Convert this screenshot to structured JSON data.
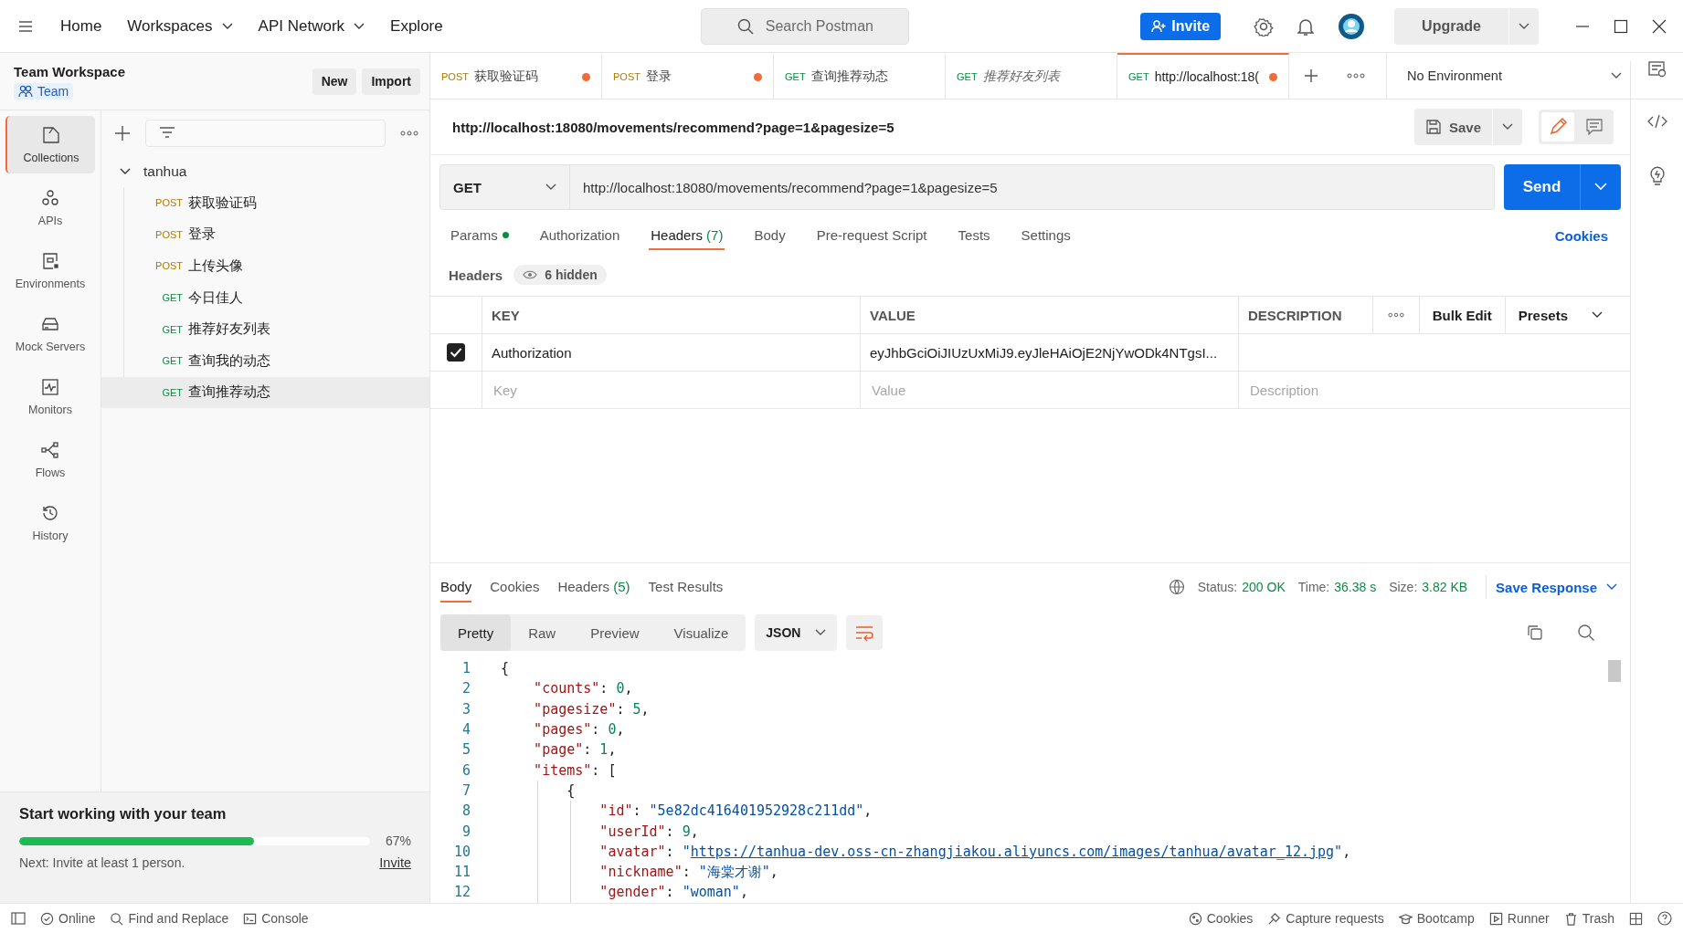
{
  "topbar": {
    "nav": [
      {
        "label": "Home",
        "dropdown": false
      },
      {
        "label": "Workspaces",
        "dropdown": true
      },
      {
        "label": "API Network",
        "dropdown": true
      },
      {
        "label": "Explore",
        "dropdown": false
      }
    ],
    "search_placeholder": "Search Postman",
    "invite": "Invite",
    "upgrade": "Upgrade"
  },
  "workspace": {
    "title": "Team Workspace",
    "badge": "Team",
    "buttons": [
      "New",
      "Import"
    ]
  },
  "rail": [
    {
      "kind": "collections",
      "label": "Collections",
      "selected": true
    },
    {
      "kind": "apis",
      "label": "APIs",
      "selected": false
    },
    {
      "kind": "environments",
      "label": "Environments",
      "selected": false
    },
    {
      "kind": "mock",
      "label": "Mock Servers",
      "selected": false
    },
    {
      "kind": "monitors",
      "label": "Monitors",
      "selected": false
    },
    {
      "kind": "flows",
      "label": "Flows",
      "selected": false
    },
    {
      "kind": "history",
      "label": "History",
      "selected": false
    }
  ],
  "collection": {
    "name": "tanhua",
    "expanded": true,
    "requests": [
      {
        "method": "POST",
        "name": "获取验证码",
        "selected": false
      },
      {
        "method": "POST",
        "name": "登录",
        "selected": false
      },
      {
        "method": "POST",
        "name": "上传头像",
        "selected": false
      },
      {
        "method": "GET",
        "name": "今日佳人",
        "selected": false
      },
      {
        "method": "GET",
        "name": "推荐好友列表",
        "selected": false
      },
      {
        "method": "GET",
        "name": "查询我的动态",
        "selected": false
      },
      {
        "method": "GET",
        "name": "查询推荐动态",
        "selected": true
      }
    ]
  },
  "onboarding": {
    "title": "Start working with your team",
    "level": 0.67,
    "percent": "67%",
    "next": "Next: Invite at least 1 person.",
    "link": "Invite"
  },
  "tabs": [
    {
      "method": "POST",
      "name": "获取验证码",
      "unsaved": true,
      "preview": false,
      "selected": false
    },
    {
      "method": "POST",
      "name": "登录",
      "unsaved": true,
      "preview": false,
      "selected": false
    },
    {
      "method": "GET",
      "name": "查询推荐动态",
      "unsaved": false,
      "preview": false,
      "selected": false
    },
    {
      "method": "GET",
      "name": "推荐好友列表",
      "unsaved": false,
      "preview": true,
      "selected": false
    },
    {
      "method": "GET",
      "name": "http://localhost:18(",
      "unsaved": true,
      "preview": false,
      "selected": true
    }
  ],
  "environment": "No Environment",
  "request": {
    "title": "http://localhost:18080/movements/recommend?page=1&pagesize=5",
    "save": "Save",
    "method": "GET",
    "url": "http://localhost:18080/movements/recommend?page=1&pagesize=5",
    "send": "Send",
    "tabs": [
      {
        "label": "Params",
        "indicator": true,
        "selected": false
      },
      {
        "label": "Authorization",
        "indicator": false,
        "selected": false
      },
      {
        "label": "Headers",
        "count": "(7)",
        "indicator": false,
        "selected": true
      },
      {
        "label": "Body",
        "indicator": false,
        "selected": false
      },
      {
        "label": "Pre-request Script",
        "indicator": false,
        "selected": false
      },
      {
        "label": "Tests",
        "indicator": false,
        "selected": false
      },
      {
        "label": "Settings",
        "indicator": false,
        "selected": false
      }
    ],
    "cookies": "Cookies"
  },
  "headers": {
    "title": "Headers",
    "hidden": "6 hidden",
    "columns": [
      "KEY",
      "VALUE",
      "DESCRIPTION"
    ],
    "bulk_edit": "Bulk Edit",
    "presets": "Presets",
    "rows": [
      {
        "checked": true,
        "key": "Authorization",
        "value": "eyJhbGciOiJIUzUxMiJ9.eyJleHAiOjE2NjYwODk4NTgsI..."
      }
    ],
    "new_row": {
      "key": {
        "placeholder": "Key"
      },
      "value": {
        "placeholder": "Value"
      },
      "description": {
        "placeholder": "Description"
      }
    }
  },
  "response": {
    "tabs": [
      {
        "label": "Body",
        "selected": true
      },
      {
        "label": "Cookies",
        "selected": false
      },
      {
        "label": "Headers",
        "count": "(5)",
        "selected": false
      },
      {
        "label": "Test Results",
        "selected": false
      }
    ],
    "status_label": "Status:",
    "status": "200 OK",
    "time_label": "Time:",
    "time": "36.38 s",
    "size_label": "Size:",
    "size": "3.82 KB",
    "save": "Save Response",
    "views": [
      {
        "label": "Pretty",
        "selected": true
      },
      {
        "label": "Raw",
        "selected": false
      },
      {
        "label": "Preview",
        "selected": false
      },
      {
        "label": "Visualize",
        "selected": false
      }
    ],
    "format": "JSON",
    "code": [
      {
        "number": "1",
        "tokens": [
          {
            "kind": "punct",
            "text": "{"
          }
        ],
        "children": [
          {
            "number": "2",
            "tokens": [
              {
                "kind": "key",
                "text": "\"counts\""
              },
              {
                "kind": "punct",
                "text": ": "
              },
              {
                "kind": "number",
                "text": "0"
              },
              {
                "kind": "punct",
                "text": ","
              }
            ]
          },
          {
            "number": "3",
            "tokens": [
              {
                "kind": "key",
                "text": "\"pagesize\""
              },
              {
                "kind": "punct",
                "text": ": "
              },
              {
                "kind": "number",
                "text": "5"
              },
              {
                "kind": "punct",
                "text": ","
              }
            ]
          },
          {
            "number": "4",
            "tokens": [
              {
                "kind": "key",
                "text": "\"pages\""
              },
              {
                "kind": "punct",
                "text": ": "
              },
              {
                "kind": "number",
                "text": "0"
              },
              {
                "kind": "punct",
                "text": ","
              }
            ]
          },
          {
            "number": "5",
            "tokens": [
              {
                "kind": "key",
                "text": "\"page\""
              },
              {
                "kind": "punct",
                "text": ": "
              },
              {
                "kind": "number",
                "text": "1"
              },
              {
                "kind": "punct",
                "text": ","
              }
            ]
          },
          {
            "number": "6",
            "tokens": [
              {
                "kind": "key",
                "text": "\"items\""
              },
              {
                "kind": "punct",
                "text": ": ["
              }
            ],
            "children": [
              {
                "number": "7",
                "tokens": [
                  {
                    "kind": "punct",
                    "text": "{"
                  }
                ],
                "children": [
                  {
                    "number": "8",
                    "tokens": [
                      {
                        "kind": "key",
                        "text": "\"id\""
                      },
                      {
                        "kind": "punct",
                        "text": ": "
                      },
                      {
                        "kind": "string",
                        "text": "\"5e82dc416401952928c211dd\""
                      },
                      {
                        "kind": "punct",
                        "text": ","
                      }
                    ]
                  },
                  {
                    "number": "9",
                    "tokens": [
                      {
                        "kind": "key",
                        "text": "\"userId\""
                      },
                      {
                        "kind": "punct",
                        "text": ": "
                      },
                      {
                        "kind": "number",
                        "text": "9"
                      },
                      {
                        "kind": "punct",
                        "text": ","
                      }
                    ]
                  },
                  {
                    "number": "10",
                    "tokens": [
                      {
                        "kind": "key",
                        "text": "\"avatar\""
                      },
                      {
                        "kind": "punct",
                        "text": ": "
                      },
                      {
                        "kind": "string",
                        "text": "\""
                      },
                      {
                        "kind": "link",
                        "text": "https://tanhua-dev.oss-cn-zhangjiakou.aliyuncs.com/images/tanhua/avatar_12.jpg"
                      },
                      {
                        "kind": "string",
                        "text": "\""
                      },
                      {
                        "kind": "punct",
                        "text": ","
                      }
                    ]
                  },
                  {
                    "number": "11",
                    "tokens": [
                      {
                        "kind": "key",
                        "text": "\"nickname\""
                      },
                      {
                        "kind": "punct",
                        "text": ": "
                      },
                      {
                        "kind": "string",
                        "text": "\"海棠才谢\""
                      },
                      {
                        "kind": "punct",
                        "text": ","
                      }
                    ]
                  },
                  {
                    "number": "12",
                    "tokens": [
                      {
                        "kind": "key",
                        "text": "\"gender\""
                      },
                      {
                        "kind": "punct",
                        "text": ": "
                      },
                      {
                        "kind": "string",
                        "text": "\"woman\""
                      },
                      {
                        "kind": "punct",
                        "text": ","
                      }
                    ]
                  }
                ]
              }
            ]
          }
        ]
      }
    ]
  },
  "status_bar": {
    "left": [
      {
        "kind": "online",
        "label": "Online"
      },
      {
        "kind": "search",
        "label": "Find and Replace"
      },
      {
        "kind": "console",
        "label": "Console"
      }
    ],
    "right": [
      {
        "kind": "cookie",
        "label": "Cookies"
      },
      {
        "kind": "capture",
        "label": "Capture requests"
      },
      {
        "kind": "bootcamp",
        "label": "Bootcamp"
      },
      {
        "kind": "runner",
        "label": "Runner"
      },
      {
        "kind": "trash",
        "label": "Trash"
      }
    ]
  }
}
